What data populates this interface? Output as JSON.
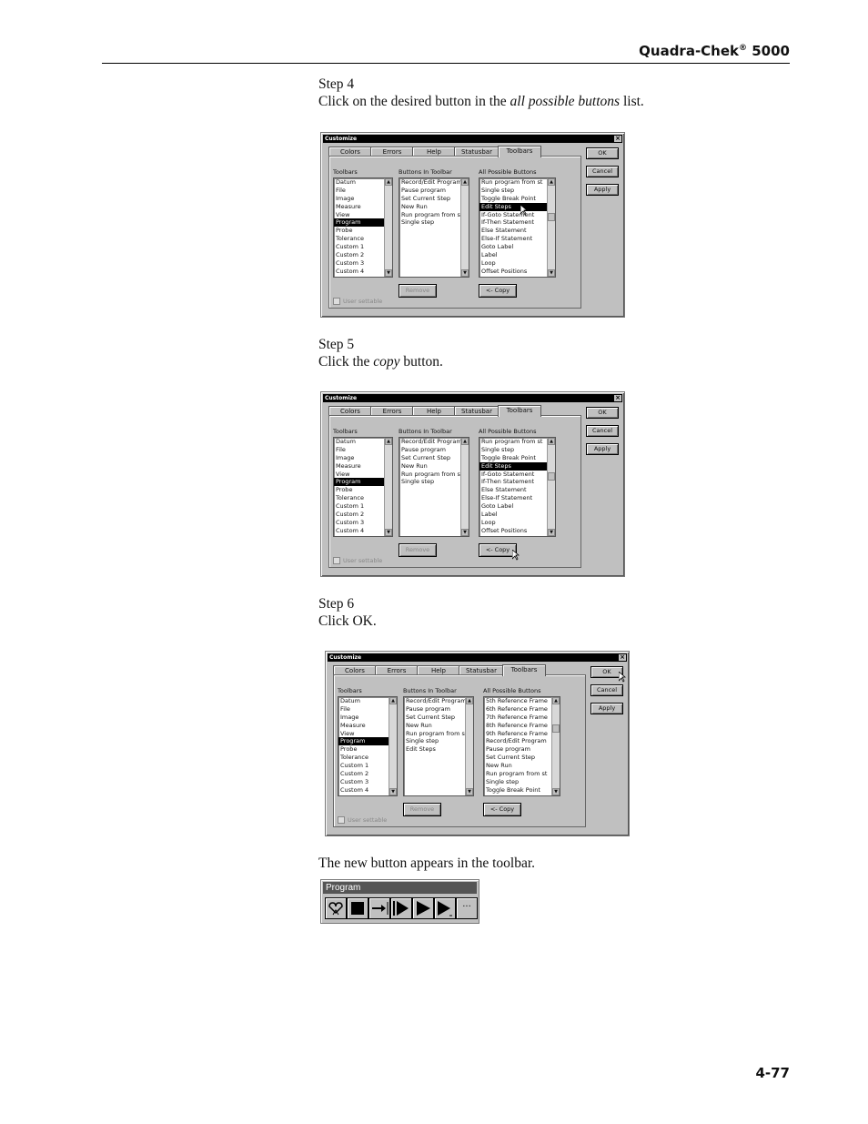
{
  "header": {
    "title": "Quadra-Chek",
    "reg": "®",
    "model": "5000"
  },
  "page_number": "4-77",
  "steps": [
    {
      "label": "Step 4",
      "pre": "Click on the desired button in the ",
      "em": "all possible buttons",
      "post": " list."
    },
    {
      "label": "Step 5",
      "pre": "Click the ",
      "em": "copy",
      "post": " button."
    },
    {
      "label": "Step 6",
      "pre": "Click OK.",
      "em": "",
      "post": ""
    }
  ],
  "closing_text": "The new button appears in the toolbar.",
  "dialog": {
    "title": "Customize",
    "tabs": [
      "Colors",
      "Errors",
      "Help",
      "Statusbar",
      "Toolbars"
    ],
    "col_labels": {
      "toolbars": "Toolbars",
      "buttons": "Buttons In Toolbar",
      "all": "All Possible Buttons"
    },
    "toolbars": [
      "Datum",
      "File",
      "Image",
      "Measure",
      "View",
      "Program",
      "Probe",
      "Tolerance",
      "Custom 1",
      "Custom 2",
      "Custom 3",
      "Custom 4"
    ],
    "ok": "OK",
    "cancel": "Cancel",
    "apply": "Apply",
    "remove": "Remove",
    "copy": "<- Copy",
    "user_settable": "User settable"
  },
  "dialogs": [
    {
      "buttons": [
        "Record/Edit Program",
        "Pause program",
        "Set Current Step",
        "New Run",
        "Run program from st",
        "Single step"
      ],
      "all": [
        "Run program from st",
        "Single step",
        "Toggle Break Point",
        "Edit Steps",
        "If-Goto Statement",
        "If-Then Statement",
        "Else Statement",
        "Else-If Statement",
        "Goto Label",
        "Label",
        "Loop",
        "Offset Positions"
      ],
      "all_sel": 3
    },
    {
      "buttons": [
        "Record/Edit Program",
        "Pause program",
        "Set Current Step",
        "New Run",
        "Run program from st",
        "Single step"
      ],
      "all": [
        "Run program from st",
        "Single step",
        "Toggle Break Point",
        "Edit Steps",
        "If-Goto Statement",
        "If-Then Statement",
        "Else Statement",
        "Else-If Statement",
        "Goto Label",
        "Label",
        "Loop",
        "Offset Positions"
      ],
      "all_sel": 3
    },
    {
      "buttons": [
        "Record/Edit Program",
        "Pause program",
        "Set Current Step",
        "New Run",
        "Run program from st",
        "Single step",
        "Edit Steps"
      ],
      "all": [
        "5th Reference Frame",
        "6th Reference Frame",
        "7th Reference Frame",
        "8th Reference Frame",
        "9th Reference Frame",
        "Record/Edit Program",
        "Pause program",
        "Set Current Step",
        "New Run",
        "Run program from st",
        "Single step",
        "Toggle Break Point"
      ],
      "all_sel": -1
    }
  ],
  "program_toolbar": {
    "title": "Program",
    "icons": [
      "heart-run-icon",
      "stop-icon",
      "step-arrow-icon",
      "play-bar-icon",
      "play-icon",
      "play-sub-icon",
      "ellipsis-icon"
    ]
  }
}
